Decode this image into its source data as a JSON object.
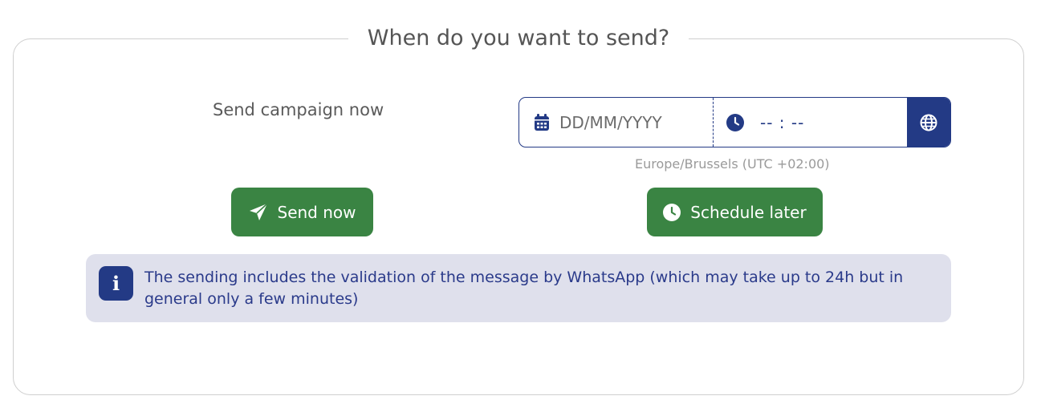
{
  "section": {
    "title": "When do you want to send?"
  },
  "send_now": {
    "label": "Send campaign now",
    "button_label": "Send now"
  },
  "schedule": {
    "date_placeholder": "DD/MM/YYYY",
    "time_placeholder": "-- : --",
    "timezone": "Europe/Brussels (UTC +02:00)",
    "button_label": "Schedule later"
  },
  "info": {
    "icon": "info-icon",
    "text": "The sending includes the validation of the message by WhatsApp (which may take up to 24h but in general only a few minutes)"
  },
  "colors": {
    "primary_navy": "#233a85",
    "button_green": "#3a8443",
    "info_bg": "#dfe0ec"
  },
  "icons": {
    "date": "calendar-icon",
    "time": "clock-icon",
    "timezone": "globe-icon",
    "send": "paper-plane-icon",
    "schedule": "clock-icon"
  }
}
